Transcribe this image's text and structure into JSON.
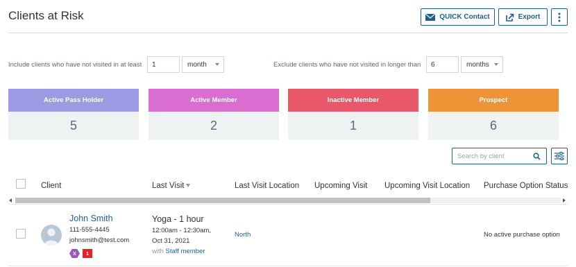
{
  "header": {
    "title": "Clients at Risk",
    "quick_contact_label": "QUICK Contact",
    "export_label": "Export"
  },
  "filters": {
    "include_label": "Include clients who have not visited in at least",
    "include_value": "1",
    "include_unit": "month",
    "exclude_label": "Exclude clients who have not visited in longer than",
    "exclude_value": "6",
    "exclude_unit": "months"
  },
  "cards": [
    {
      "label": "Active Pass Holder",
      "value": "5",
      "color": "#9b9be3"
    },
    {
      "label": "Active Member",
      "value": "2",
      "color": "#d96ed0"
    },
    {
      "label": "Inactive Member",
      "value": "1",
      "color": "#e8576a"
    },
    {
      "label": "Prospect",
      "value": "6",
      "color": "#ee9437"
    }
  ],
  "search": {
    "placeholder": "Search by client"
  },
  "table": {
    "columns": [
      "Client",
      "Last Visit",
      "Last Visit Location",
      "Upcoming Visit",
      "Upcoming Visit Location",
      "Purchase Option Status"
    ],
    "sorted_column": "Last Visit",
    "rows": [
      {
        "client_name": "John Smith",
        "phone": "111-555-4445",
        "email": "johnsmith@test.com",
        "badge_hex_letter": "X",
        "badge_red_text": "1",
        "visit_title": "Yoga - 1 hour",
        "visit_time": "12:00am - 12:30am,",
        "visit_date": "Oct 31, 2021",
        "with_label": "with",
        "staff": "Staff member",
        "location": "North",
        "purchase_status": "No active purchase option"
      }
    ]
  },
  "colors": {
    "accent": "#1f5f8b",
    "badge_purple": "#9b59b6",
    "badge_red": "#e8202a"
  }
}
